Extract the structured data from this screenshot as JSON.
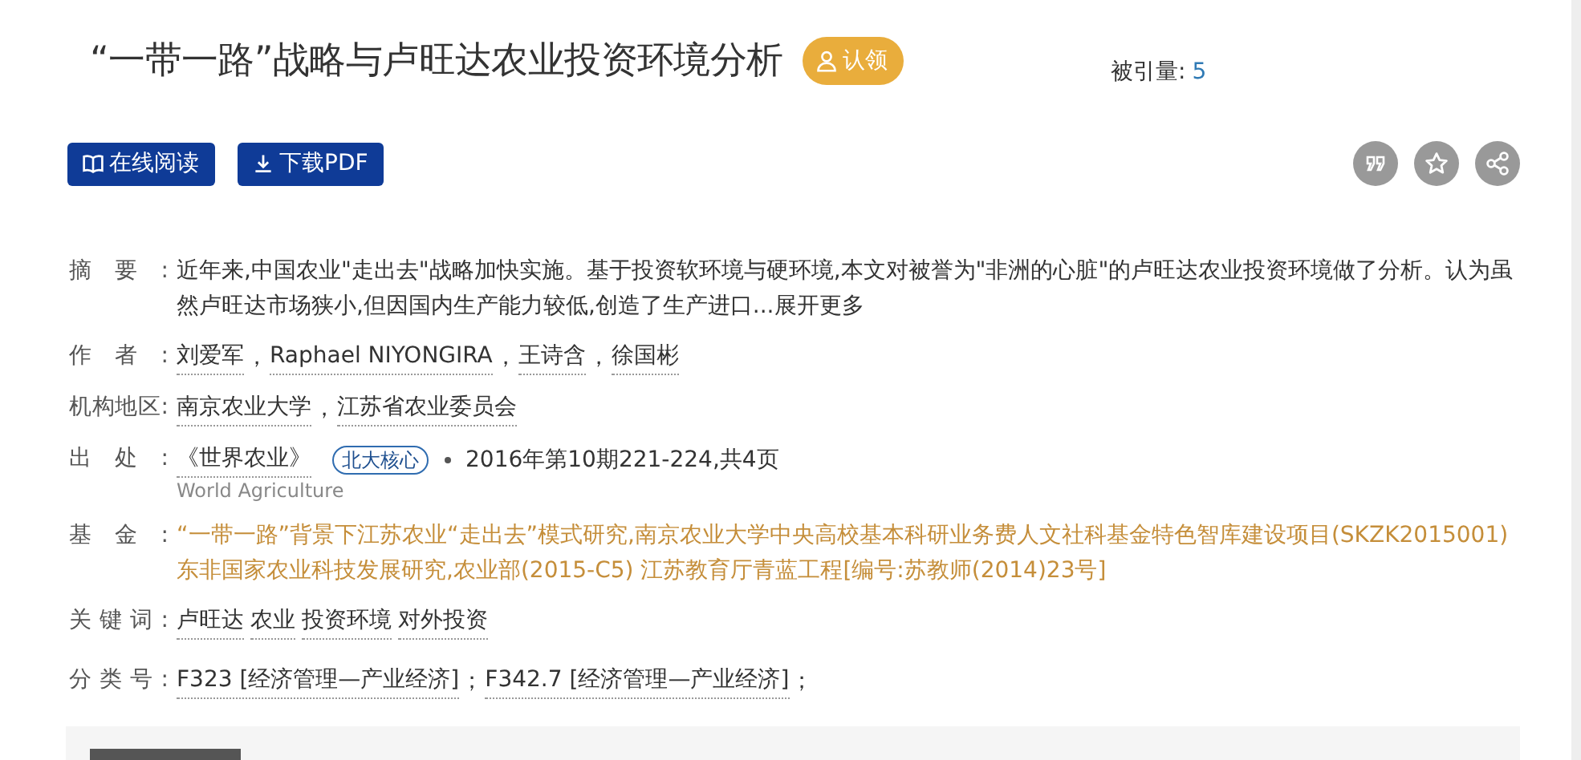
{
  "title": "“一带一路”战略与卢旺达农业投资环境分析",
  "claim_button": "认领",
  "citations": {
    "label": "被引量:",
    "value": "5"
  },
  "actions": [
    {
      "label": "在线阅读",
      "kind": "read"
    },
    {
      "label": "下载PDF",
      "kind": "download"
    }
  ],
  "tools": [
    {
      "kind": "quote"
    },
    {
      "kind": "star"
    },
    {
      "kind": "share"
    }
  ],
  "fields": [
    {
      "kind": "abstract",
      "label": "摘要:",
      "text": "近年来,中国农业\"走出去\"战略加快实施。基于投资软环境与硬环境,本文对被誉为\"非洲的心脏\"的卢旺达农业投资环境做了分析。认为虽然卢旺达市场狭小,但因国内生产能力较低,创造了生产进口...",
      "more": "展开更多"
    },
    {
      "kind": "links",
      "label": "作者:",
      "items": [
        "刘爱军",
        "Raphael NIYONGIRA",
        "王诗含",
        "徐国彬"
      ],
      "separator": "，"
    },
    {
      "kind": "links",
      "label": "机构地区:",
      "items": [
        "南京农业大学",
        "江苏省农业委员会"
      ],
      "separator": "，"
    },
    {
      "kind": "source",
      "label": "出处:",
      "journal": "《世界农业》",
      "badge": "北大核心",
      "issue": "2016年第10期221-224,共4页",
      "subtitle": "World Agriculture"
    },
    {
      "kind": "fund",
      "label": "基金:",
      "text": "“一带一路”背景下江苏农业“走出去”模式研究,南京农业大学中央高校基本科研业务费人文社科基金特色智库建设项目(SKZK2015001) 东非国家农业科技发展研究,农业部(2015-C5) 江苏教育厅青蓝工程[编号:苏教师(2014)23号]"
    },
    {
      "kind": "links",
      "label": "关键词:",
      "items": [
        "卢旺达",
        "农业",
        "投资环境",
        "对外投资"
      ]
    },
    {
      "kind": "links",
      "label": "分类号:",
      "items": [
        "F323 [经济管理—产业经济]",
        "F342.7 [经济管理—产业经济]"
      ],
      "separator": "；",
      "trailing": "；"
    }
  ]
}
